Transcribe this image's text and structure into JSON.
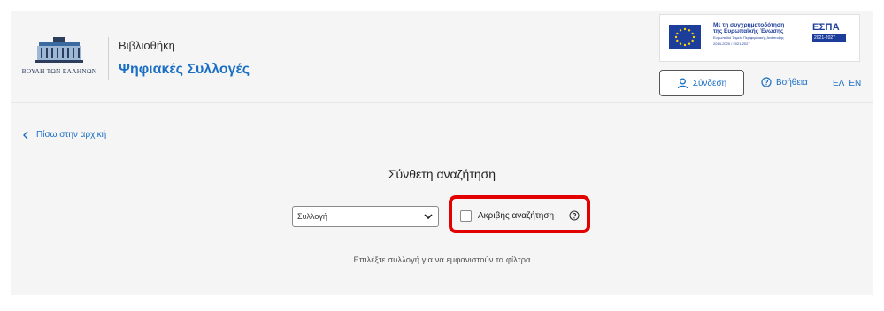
{
  "header": {
    "logo_text": "ΒΟΥΛΗ ΤΩΝ ΕΛΛΗΝΩΝ",
    "library_label": "Βιβλιοθήκη",
    "collections_label": "Ψηφιακές Συλλογές",
    "login_label": "Σύνδεση",
    "help_label": "Βοήθεια",
    "lang_el": "ΕΛ",
    "lang_en": "EN"
  },
  "espa_banner": {
    "line1": "Με τη συγχρηματοδότηση",
    "line2": "της Ευρωπαϊκής Ένωσης",
    "small1": "Ευρωπαϊκό Ταμείο Περιφερειακής Ανάπτυξης",
    "small2": "2014-2020 / 2021-2027",
    "espa_name": "ΕΣΠΑ",
    "espa_years": "2021-2027"
  },
  "nav": {
    "back_label": "Πίσω στην αρχική"
  },
  "search": {
    "title": "Σύνθετη αναζήτηση",
    "collection_selected": "Συλλογή",
    "exact_label": "Ακριβής αναζήτηση",
    "exact_checked": false,
    "hint": "Επιλέξτε συλλογή για να εμφανιστούν τα φίλτρα"
  },
  "colors": {
    "accent": "#1a6fc4",
    "highlight": "#e30000",
    "panel_bg": "#f5f5f5"
  }
}
